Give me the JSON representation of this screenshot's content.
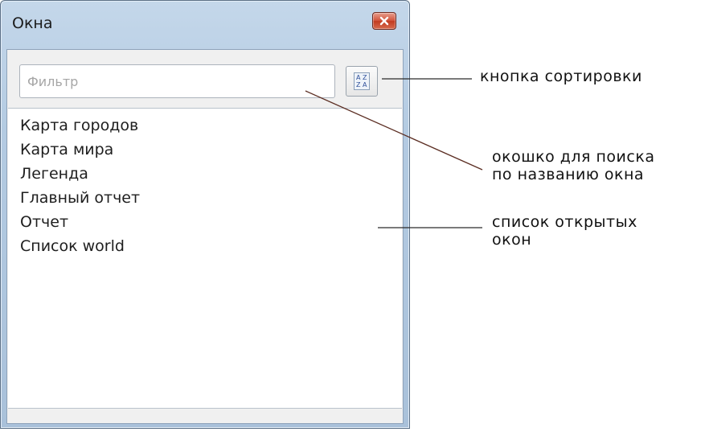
{
  "window": {
    "title": "Окна",
    "close_icon": "close-icon"
  },
  "filter": {
    "placeholder": "Фильтр",
    "value": ""
  },
  "sort_button": {
    "icon": "sort-az-icon",
    "icon_letters": [
      "A",
      "Z",
      "Z",
      "A"
    ]
  },
  "window_list": {
    "items": [
      "Карта городов",
      "Карта мира",
      "Легенда",
      "Главный отчет",
      "Отчет",
      "Список world"
    ]
  },
  "annotations": {
    "sort_button": "кнопка сортировки",
    "search_line1": "окошко для поиска",
    "search_line2": "по названию окна",
    "list_line1": "список открытых",
    "list_line2": "окон"
  },
  "colors": {
    "frame": "#b4cbe2",
    "close_button": "#c13b20",
    "sort_icon_letters": "#2d4f9a"
  }
}
